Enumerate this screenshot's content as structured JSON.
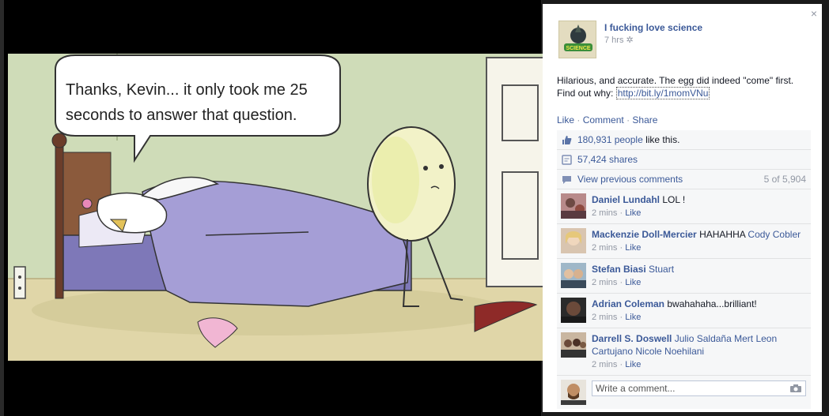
{
  "close": "×",
  "post": {
    "page_name": "I fucking love science",
    "time": "7 hrs",
    "avatar_text": "SCIENCE",
    "text": "Hilarious, and accurate. The egg did indeed \"come\" first. Find out why: ",
    "link": "http://bit.ly/1momVNu",
    "actions": [
      "Like",
      "Comment",
      "Share"
    ]
  },
  "ufi": {
    "likes_count": "180,931 people",
    "likes_suffix": " like this.",
    "shares": "57,424 shares",
    "view_previous": "View previous comments",
    "comment_count": "5 of 5,904"
  },
  "comments": [
    {
      "name": "Daniel Lundahl",
      "text": "LOL !",
      "time": "2 mins",
      "like": "Like"
    },
    {
      "name": "Mackenzie Doll-Mercier",
      "text": "HAHAHHA",
      "tag": "Cody Cobler",
      "time": "2 mins",
      "like": "Like"
    },
    {
      "name": "Stefan Biasi",
      "tag": "Stuart",
      "text": "",
      "time": "2 mins",
      "like": "Like"
    },
    {
      "name": "Adrian Coleman",
      "text": "bwahahaha...brilliant!",
      "time": "2 mins",
      "like": "Like"
    },
    {
      "name": "Darrell S. Doswell",
      "tag": "Julio Saldaña Mert Leon Cartujano Nicole Noehilani",
      "text": "",
      "time": "2 mins",
      "like": "Like"
    }
  ],
  "write": {
    "placeholder": "Write a comment..."
  },
  "comic": {
    "speech_line1": "Thanks, Kevin... it only took me 25",
    "speech_line2": "seconds to answer that question."
  },
  "colors": {
    "link": "#3b5998",
    "muted": "#9197a3",
    "ufi_bg": "#f6f7f8"
  }
}
